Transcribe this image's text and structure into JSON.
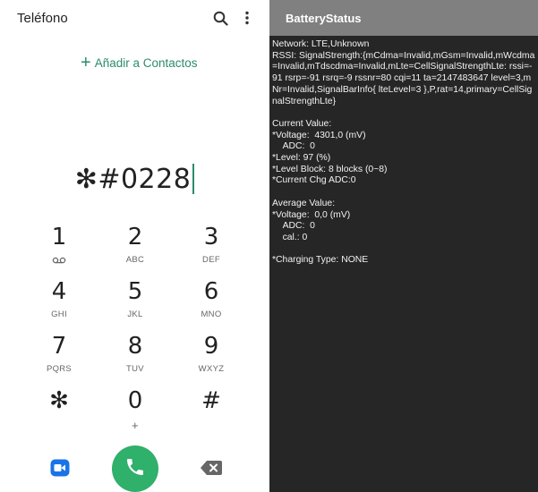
{
  "dialer": {
    "title": "Teléfono",
    "add_contacts": "Añadir a Contactos",
    "number": "✻#0228",
    "keys": [
      {
        "digit": "1",
        "letters": ""
      },
      {
        "digit": "2",
        "letters": "ABC"
      },
      {
        "digit": "3",
        "letters": "DEF"
      },
      {
        "digit": "4",
        "letters": "GHI"
      },
      {
        "digit": "5",
        "letters": "JKL"
      },
      {
        "digit": "6",
        "letters": "MNO"
      },
      {
        "digit": "7",
        "letters": "PQRS"
      },
      {
        "digit": "8",
        "letters": "TUV"
      },
      {
        "digit": "9",
        "letters": "WXYZ"
      },
      {
        "digit": "✻",
        "letters": ""
      },
      {
        "digit": "0",
        "letters": "+"
      },
      {
        "digit": "#",
        "letters": ""
      }
    ],
    "icons": {
      "search": "search-icon",
      "more": "more-vertical-icon",
      "voicemail": "voicemail-icon",
      "call": "phone-icon",
      "video": "video-call-icon",
      "backspace": "backspace-icon"
    },
    "colors": {
      "accent": "#2a8c6a",
      "call_button": "#2fb06b",
      "video_icon": "#1a73e8"
    }
  },
  "battery_status": {
    "title": "BatteryStatus",
    "lines": [
      "Network: LTE,Unknown",
      "RSSI: SignalStrength:{mCdma=Invalid,mGsm=Invalid,mWcdma=Invalid,mTdscdma=Invalid,mLte=CellSignalStrengthLte: rssi=-91 rsrp=-91 rsrq=-9 rssnr=80 cqi=11 ta=2147483647 level=3,mNr=Invalid,SignalBarInfo{ lteLevel=3 },P,rat=14,primary=CellSignalStrengthLte}",
      "",
      "Current Value:",
      "*Voltage:  4301,0 (mV)",
      "    ADC:  0",
      "*Level: 97 (%)",
      "*Level Block: 8 blocks (0~8)",
      "*Current Chg ADC:0",
      "",
      "Average Value:",
      "*Voltage:  0,0 (mV)",
      "    ADC:  0",
      "    cal.: 0",
      "",
      "*Charging Type: NONE"
    ],
    "colors": {
      "background": "#262626",
      "titlebar": "#808080",
      "text": "#f2f2f2"
    }
  }
}
